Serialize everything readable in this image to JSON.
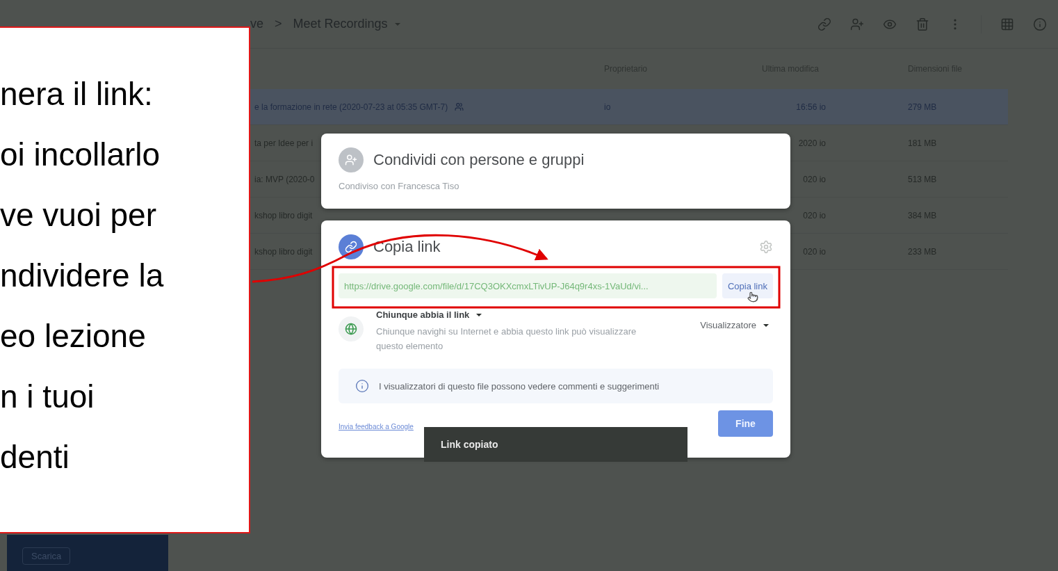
{
  "breadcrumb": {
    "parent": "ve",
    "separator": ">",
    "current": "Meet Recordings"
  },
  "columns": [
    "Proprietario",
    "Ultima modifica",
    "Dimensioni file"
  ],
  "rows": [
    {
      "name": "e la formazione in rete (2020-07-23 at 05:35 GMT-7)",
      "shared": true,
      "owner": "io",
      "modified": "16:56 io",
      "size": "279 MB",
      "selected": true
    },
    {
      "name": "ta per Idee per i",
      "shared": false,
      "modified": "2020 io",
      "size": "181 MB",
      "selected": false
    },
    {
      "name": "ia: MVP (2020-0",
      "shared": false,
      "modified": "020 io",
      "size": "513 MB",
      "selected": false
    },
    {
      "name": "kshop libro digit",
      "shared": false,
      "modified": "020 io",
      "size": "384 MB",
      "selected": false
    },
    {
      "name": "kshop libro digit",
      "shared": false,
      "modified": "020 io",
      "size": "233 MB",
      "selected": false
    }
  ],
  "sidebar": {
    "button": "Scarica"
  },
  "share_card": {
    "title": "Condividi con persone e gruppi",
    "subtitle": "Condiviso con Francesca Tiso"
  },
  "link_card": {
    "title": "Copia link",
    "url": "https://drive.google.com/file/d/17CQ3OKXcmxLTivUP-J64q9r4xs-1VaUd/vi...",
    "copy_button": "Copia link",
    "access": {
      "label": "Chiunque abbia il link",
      "description": "Chiunque navighi su Internet e abbia questo link può visualizzare questo elemento",
      "role": "Visualizzatore"
    },
    "info": "I visualizzatori di questo file possono vedere commenti e suggerimenti",
    "feedback_link": "Invia feedback a Google",
    "done_button": "Fine"
  },
  "toast": "Link copiato",
  "callout": {
    "lines": [
      "nera il link:",
      "oi incollarlo",
      "ve vuoi per",
      "ndividere la",
      "eo lezione",
      "n i tuoi",
      "denti"
    ]
  }
}
